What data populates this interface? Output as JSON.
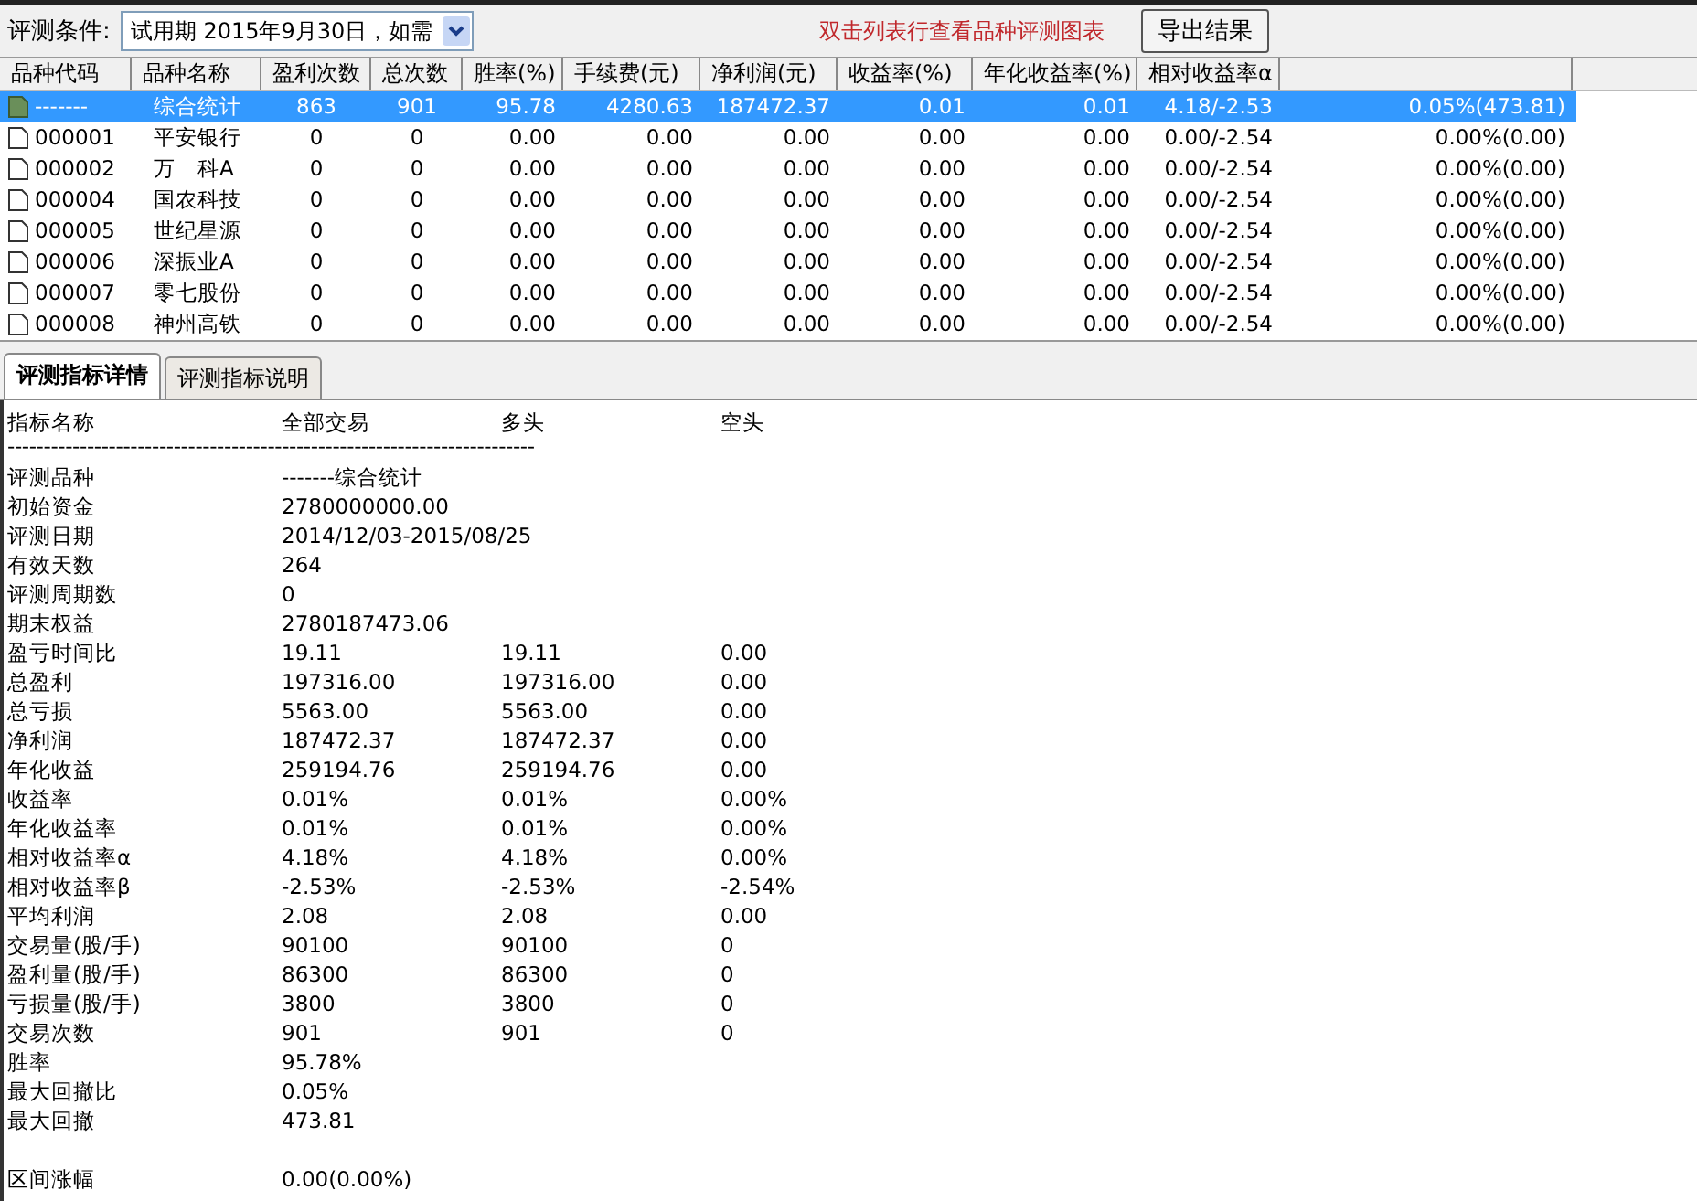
{
  "toolbar": {
    "condition_label": "评测条件:",
    "condition_value": "试用期 2015年9月30日，如需",
    "hint": "双击列表行查看品种评测图表",
    "export_button": "导出结果"
  },
  "table": {
    "columns": [
      {
        "label": "品种代码"
      },
      {
        "label": "品种名称"
      },
      {
        "label": "盈利次数"
      },
      {
        "label": "总次数"
      },
      {
        "label": "胜率(%)"
      },
      {
        "label": "手续费(元)"
      },
      {
        "label": "净利润(元)"
      },
      {
        "label": "收益率(%)"
      },
      {
        "label": "年化收益率(%)"
      },
      {
        "label": "相对收益率α"
      },
      {}
    ],
    "rows": [
      {
        "selected": true,
        "cells": [
          "-------",
          "综合统计",
          "863",
          "901",
          "95.78",
          "4280.63",
          "187472.37",
          "0.01",
          "0.01",
          "4.18/-2.53",
          "0.05%(473.81)"
        ]
      },
      {
        "selected": false,
        "cells": [
          "000001",
          "平安银行",
          "0",
          "0",
          "0.00",
          "0.00",
          "0.00",
          "0.00",
          "0.00",
          "0.00/-2.54",
          "0.00%(0.00)"
        ]
      },
      {
        "selected": false,
        "cells": [
          "000002",
          "万　科A",
          "0",
          "0",
          "0.00",
          "0.00",
          "0.00",
          "0.00",
          "0.00",
          "0.00/-2.54",
          "0.00%(0.00)"
        ]
      },
      {
        "selected": false,
        "cells": [
          "000004",
          "国农科技",
          "0",
          "0",
          "0.00",
          "0.00",
          "0.00",
          "0.00",
          "0.00",
          "0.00/-2.54",
          "0.00%(0.00)"
        ]
      },
      {
        "selected": false,
        "cells": [
          "000005",
          "世纪星源",
          "0",
          "0",
          "0.00",
          "0.00",
          "0.00",
          "0.00",
          "0.00",
          "0.00/-2.54",
          "0.00%(0.00)"
        ]
      },
      {
        "selected": false,
        "cells": [
          "000006",
          "深振业A",
          "0",
          "0",
          "0.00",
          "0.00",
          "0.00",
          "0.00",
          "0.00",
          "0.00/-2.54",
          "0.00%(0.00)"
        ]
      },
      {
        "selected": false,
        "cells": [
          "000007",
          "零七股份",
          "0",
          "0",
          "0.00",
          "0.00",
          "0.00",
          "0.00",
          "0.00",
          "0.00/-2.54",
          "0.00%(0.00)"
        ]
      },
      {
        "selected": false,
        "cells": [
          "000008",
          "神州高铁",
          "0",
          "0",
          "0.00",
          "0.00",
          "0.00",
          "0.00",
          "0.00",
          "0.00/-2.54",
          "0.00%(0.00)"
        ]
      }
    ]
  },
  "tabs": [
    {
      "label": "评测指标详情",
      "selected": true
    },
    {
      "label": "评测指标说明",
      "selected": false
    }
  ],
  "details": {
    "header": [
      "指标名称",
      "全部交易",
      "多头",
      "空头"
    ],
    "separator": "-------------------------------------------------------------------------",
    "rows": [
      [
        "评测品种",
        "-------综合统计"
      ],
      [
        "初始资金",
        "2780000000.00"
      ],
      [
        "评测日期",
        "2014/12/03-2015/08/25"
      ],
      [
        "有效天数",
        "264"
      ],
      [
        "评测周期数",
        "0"
      ],
      [
        "期末权益",
        "2780187473.06"
      ],
      [
        "盈亏时间比",
        "19.11",
        "19.11",
        "0.00"
      ],
      [
        "总盈利",
        "197316.00",
        "197316.00",
        "0.00"
      ],
      [
        "总亏损",
        "5563.00",
        "5563.00",
        "0.00"
      ],
      [
        "净利润",
        "187472.37",
        "187472.37",
        "0.00"
      ],
      [
        "年化收益",
        "259194.76",
        "259194.76",
        "0.00"
      ],
      [
        "收益率",
        "0.01%",
        "0.01%",
        "0.00%"
      ],
      [
        "年化收益率",
        "0.01%",
        "0.01%",
        "0.00%"
      ],
      [
        "相对收益率α",
        "4.18%",
        "4.18%",
        "0.00%"
      ],
      [
        "相对收益率β",
        "-2.53%",
        "-2.53%",
        "-2.54%"
      ],
      [
        "平均利润",
        "2.08",
        "2.08",
        "0.00"
      ],
      [
        "交易量(股/手)",
        "90100",
        "90100",
        "0"
      ],
      [
        "盈利量(股/手)",
        "86300",
        "86300",
        "0"
      ],
      [
        "亏损量(股/手)",
        "3800",
        "3800",
        "0"
      ],
      [
        "交易次数",
        "901",
        "901",
        "0"
      ],
      [
        "胜率",
        "95.78%"
      ],
      [
        "最大回撤比",
        "0.05%"
      ],
      [
        "最大回撤",
        "473.81"
      ],
      [],
      [
        "区间涨幅",
        "0.00(0.00%)"
      ]
    ]
  }
}
